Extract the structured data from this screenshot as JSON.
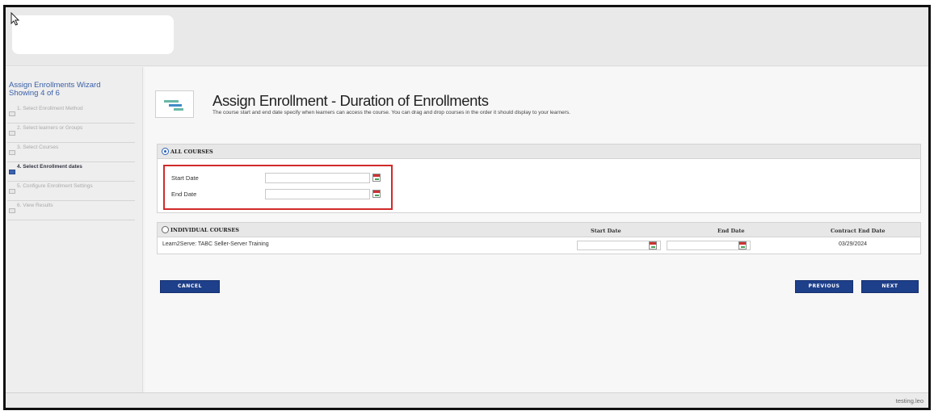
{
  "wizard": {
    "title": "Assign Enrollments Wizard Showing 4 of 6",
    "steps": [
      {
        "label": "1. Select Enrollment Method",
        "active": false
      },
      {
        "label": "2. Select learners or Groups",
        "active": false
      },
      {
        "label": "3. Select Courses",
        "active": false
      },
      {
        "label": "4. Select Enrollment dates",
        "active": true
      },
      {
        "label": "5. Configure Enrollment Settings",
        "active": false
      },
      {
        "label": "6. View Results",
        "active": false
      }
    ]
  },
  "page": {
    "title": "Assign Enrollment - Duration of Enrollments",
    "subtitle": "The course start and end date specify when learners can access the course. You can drag and drop courses in the order it should display to your learners."
  },
  "all_courses": {
    "label": "ALL COURSES",
    "selected": true,
    "start_label": "Start Date",
    "start_value": "",
    "end_label": "End Date",
    "end_value": ""
  },
  "individual_courses": {
    "label": "INDIVIDUAL COURSES",
    "selected": false,
    "columns": {
      "start": "Start Date",
      "end": "End Date",
      "contract": "Contract End Date"
    },
    "rows": [
      {
        "course": "Learn2Serve: TABC Seller-Server Training",
        "start": "",
        "end": "",
        "contract_end": "03/29/2024"
      }
    ]
  },
  "buttons": {
    "cancel": "CANCEL",
    "previous": "PREVIOUS",
    "next": "NEXT"
  },
  "footer": {
    "text": "testing.leo"
  },
  "colors": {
    "accent": "#1e3f8a",
    "highlight_border": "#d12a2a",
    "link": "#3a5fa8"
  },
  "icons": [
    "cursor-icon",
    "wizard-step-icon",
    "enrollment-page-icon",
    "radio-icon",
    "calendar-icon"
  ]
}
